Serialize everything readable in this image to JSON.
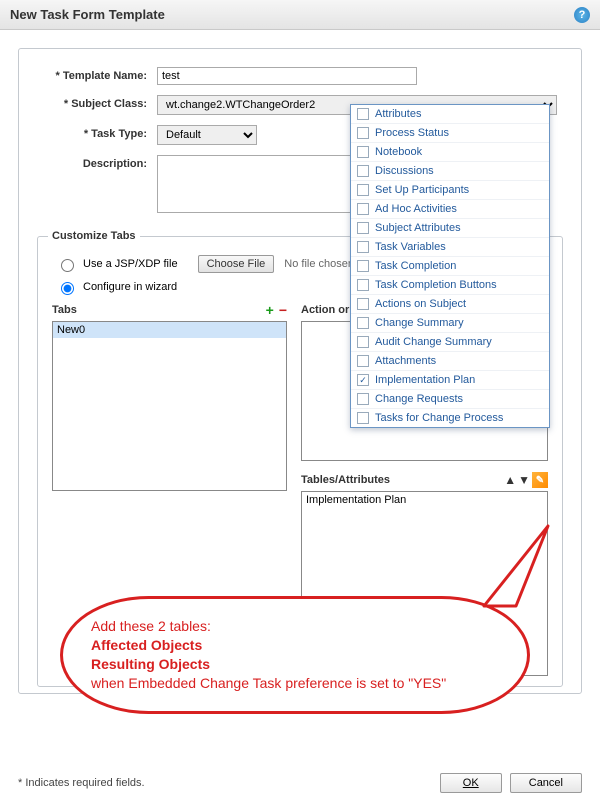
{
  "title": "New Task Form Template",
  "help_tooltip": "?",
  "form": {
    "template_name_label": "* Template Name:",
    "template_name_value": "test",
    "subject_class_label": "* Subject Class:",
    "subject_class_value": "wt.change2.WTChangeOrder2",
    "task_type_label": "* Task Type:",
    "task_type_value": "Default",
    "description_label": "Description:",
    "description_value": ""
  },
  "customize": {
    "legend": "Customize Tabs",
    "radio_jsp_label": "Use a JSP/XDP file",
    "radio_wizard_label": "Configure in wizard",
    "choose_file_btn": "Choose File",
    "no_file_text": "No file chosen",
    "tabs_header": "Tabs",
    "action_header": "Action or",
    "tables_header": "Tables/Attributes",
    "tabs_items": [
      "New0"
    ],
    "tables_items": [
      "Implementation Plan"
    ]
  },
  "dropdown_items": [
    {
      "label": "Attributes",
      "checked": false
    },
    {
      "label": "Process Status",
      "checked": false
    },
    {
      "label": "Notebook",
      "checked": false
    },
    {
      "label": "Discussions",
      "checked": false
    },
    {
      "label": "Set Up Participants",
      "checked": false
    },
    {
      "label": "Ad Hoc Activities",
      "checked": false
    },
    {
      "label": "Subject Attributes",
      "checked": false
    },
    {
      "label": "Task Variables",
      "checked": false
    },
    {
      "label": "Task Completion",
      "checked": false
    },
    {
      "label": "Task Completion Buttons",
      "checked": false
    },
    {
      "label": "Actions on Subject",
      "checked": false
    },
    {
      "label": "Change Summary",
      "checked": false
    },
    {
      "label": "Audit Change Summary",
      "checked": false
    },
    {
      "label": "Attachments",
      "checked": false
    },
    {
      "label": "Implementation Plan",
      "checked": true
    },
    {
      "label": "Change Requests",
      "checked": false
    },
    {
      "label": "Tasks for Change Process",
      "checked": false
    }
  ],
  "bubble": {
    "line1": "Add these 2 tables:",
    "line2": "Affected Objects",
    "line3": "Resulting Objects",
    "line4": "when Embedded Change Task preference is set to \"YES\""
  },
  "footer": {
    "required_note": "* Indicates required fields.",
    "ok": "OK",
    "cancel": "Cancel"
  },
  "icons": {
    "plus": "+",
    "minus": "−",
    "up": "▲",
    "down": "▼",
    "pencil": "✎",
    "check": "✓"
  }
}
